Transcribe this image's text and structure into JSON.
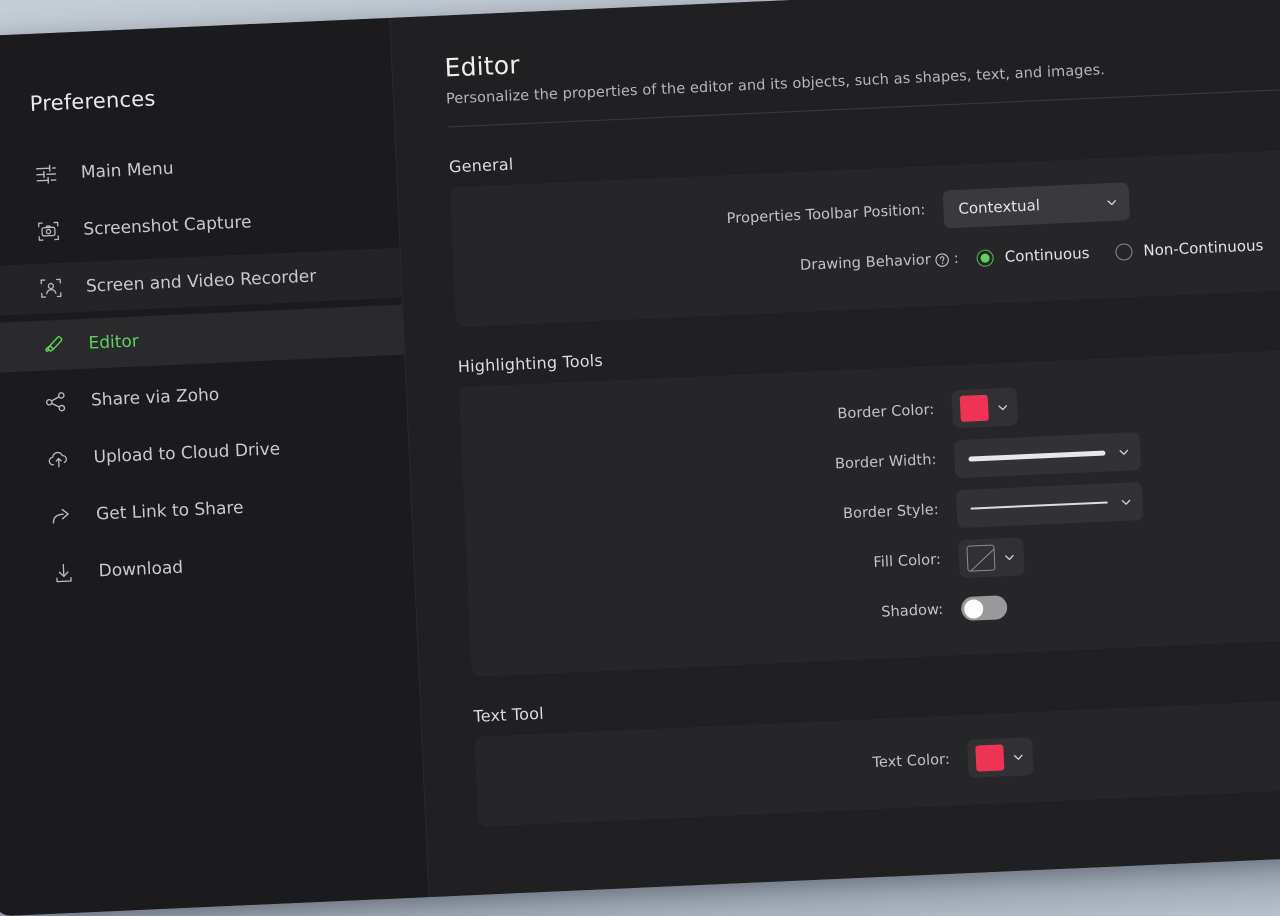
{
  "theme": {
    "backdrop": "#c6ced8",
    "window_bg": "#1d1d1f",
    "sidebar_bg": "#1b1b1d",
    "content_bg": "#202022",
    "card_bg": "#262628",
    "accent_green": "#5ed15e",
    "accent_red": "#ee3355",
    "text_primary": "#eceded",
    "text_secondary": "#b6b7b9"
  },
  "sidebar": {
    "title": "Preferences",
    "items": [
      {
        "label": "Main Menu",
        "icon": "sliders-icon",
        "active": false
      },
      {
        "label": "Screenshot Capture",
        "icon": "camera-capture-icon",
        "active": false
      },
      {
        "label": "Screen and Video Recorder",
        "icon": "person-capture-icon",
        "active": false
      },
      {
        "label": "Editor",
        "icon": "highlighter-pen-icon",
        "active": true
      },
      {
        "label": "Share via Zoho",
        "icon": "share-nodes-icon",
        "active": false
      },
      {
        "label": "Upload to Cloud Drive",
        "icon": "cloud-upload-icon",
        "active": false
      },
      {
        "label": "Get Link to Share",
        "icon": "forward-arrow-icon",
        "active": false
      },
      {
        "label": "Download",
        "icon": "download-icon",
        "active": false
      }
    ]
  },
  "header": {
    "title": "Editor",
    "subtitle": "Personalize the properties of the editor and its objects, such as shapes, text, and images."
  },
  "general": {
    "section_title": "General",
    "toolbar_position": {
      "label": "Properties Toolbar Position:",
      "value": "Contextual",
      "chevron": "chevron-down-icon"
    },
    "drawing_behavior": {
      "label": "Drawing Behavior",
      "help_icon": "help-circle-icon",
      "separator": ":",
      "options": [
        {
          "label": "Continuous",
          "selected": true
        },
        {
          "label": "Non-Continuous",
          "selected": false
        }
      ]
    }
  },
  "highlighting_tools": {
    "section_title": "Highlighting Tools",
    "border_color": {
      "label": "Border Color:",
      "swatch_color": "#ee3355",
      "chevron": "chevron-down-icon"
    },
    "border_width": {
      "label": "Border Width:",
      "preview": "thick-line",
      "chevron": "chevron-down-icon"
    },
    "border_style": {
      "label": "Border Style:",
      "preview": "thin-solid-line",
      "chevron": "chevron-down-icon"
    },
    "fill_color": {
      "label": "Fill Color:",
      "swatch_color": "none",
      "chevron": "chevron-down-icon"
    },
    "shadow": {
      "label": "Shadow:",
      "enabled": false
    }
  },
  "text_tool": {
    "section_title": "Text Tool",
    "text_color": {
      "label": "Text Color:",
      "swatch_color": "#ee3355",
      "chevron": "chevron-down-icon"
    }
  }
}
